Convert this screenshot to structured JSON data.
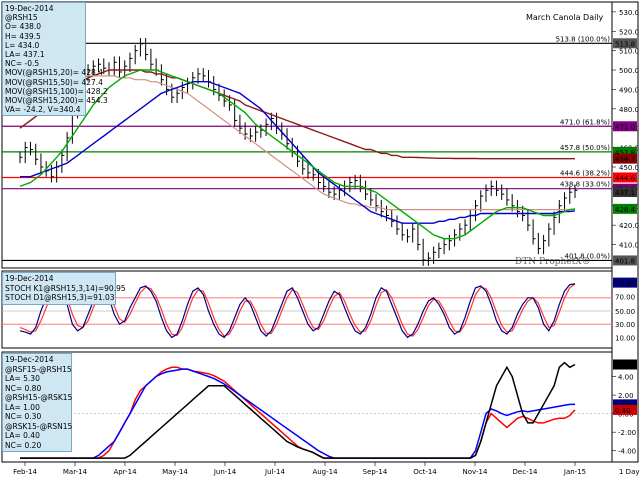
{
  "chart_data": [
    {
      "type": "line",
      "panel": "price",
      "title": "March Canola Daily",
      "ylim": [
        401,
        532
      ],
      "yticks": [
        410,
        420,
        430,
        440,
        450,
        460,
        470,
        480,
        490,
        500,
        510,
        520,
        530
      ],
      "price": [
        455,
        460,
        459,
        454,
        450,
        448,
        445,
        450,
        456,
        465,
        478,
        492,
        497,
        500,
        502,
        503,
        501,
        500,
        504,
        499,
        502,
        506,
        510,
        513.5,
        508,
        503,
        500,
        495,
        490,
        486,
        488,
        491,
        493,
        496,
        498,
        497,
        494,
        490,
        487,
        484,
        482,
        474,
        470,
        467,
        466,
        468,
        469,
        472,
        475,
        470,
        467,
        462,
        458,
        453,
        449,
        447,
        446,
        442,
        440,
        437,
        436,
        438,
        440,
        442,
        443,
        440,
        436,
        433,
        430,
        427,
        425,
        422,
        418,
        415,
        414,
        418,
        410,
        402,
        403,
        406,
        408,
        410,
        412,
        415,
        418,
        420,
        425,
        430,
        435,
        438,
        440,
        438,
        436,
        433,
        430,
        427,
        425,
        420,
        413,
        408,
        412,
        418,
        424,
        430,
        434,
        437,
        438
      ],
      "sma20": [
        440,
        441,
        442,
        444,
        446,
        449,
        452,
        455,
        458,
        462,
        466,
        470,
        474,
        478,
        482,
        485,
        488,
        491,
        493,
        495,
        497,
        498,
        499,
        500,
        500,
        500,
        500,
        499,
        498,
        497,
        496,
        495,
        494,
        493,
        492,
        491,
        490,
        489,
        488,
        486,
        484,
        482,
        480,
        478,
        475,
        472,
        470,
        468,
        466,
        464,
        462,
        460,
        458,
        456,
        454,
        452,
        450,
        448,
        446,
        444,
        442,
        441,
        440,
        440,
        440,
        440,
        439,
        438,
        437,
        435,
        433,
        431,
        429,
        427,
        425,
        423,
        421,
        419,
        417,
        415,
        414,
        413,
        413,
        413,
        414,
        415,
        417,
        419,
        421,
        423,
        425,
        427,
        428,
        429,
        429,
        429,
        429,
        428,
        427,
        426,
        425,
        425,
        425,
        426,
        427,
        428,
        428.4
      ],
      "sma50": [
        445,
        445,
        445,
        446,
        447,
        448,
        449,
        450,
        451,
        452,
        454,
        456,
        458,
        460,
        462,
        464,
        466,
        468,
        470,
        472,
        474,
        476,
        478,
        480,
        482,
        484,
        486,
        488,
        489,
        490,
        491,
        492,
        493,
        494,
        494,
        494,
        494,
        493,
        492,
        491,
        490,
        489,
        488,
        486,
        484,
        482,
        480,
        477,
        474,
        471,
        468,
        465,
        462,
        459,
        456,
        453,
        450,
        447,
        445,
        443,
        441,
        439,
        437,
        435,
        433,
        431,
        429,
        427,
        426,
        425,
        424,
        423,
        422,
        421,
        421,
        421,
        421,
        421,
        421,
        421,
        422,
        422,
        423,
        423,
        424,
        424,
        425,
        425,
        426,
        426,
        426,
        426,
        426,
        426,
        426,
        426,
        426,
        426,
        426,
        426,
        426,
        426,
        426,
        427,
        427,
        427,
        427.4
      ],
      "sma100": [
        480,
        482,
        484,
        486,
        488,
        489,
        490,
        491,
        492,
        493,
        494,
        495,
        496,
        497,
        497,
        497,
        497,
        497,
        497,
        496,
        496,
        496,
        495,
        495,
        495,
        494,
        494,
        493,
        492,
        491,
        490,
        489,
        488,
        486,
        484,
        482,
        480,
        478,
        476,
        474,
        472,
        470,
        468,
        466,
        464,
        462,
        460,
        458,
        456,
        454,
        452,
        450,
        448,
        446,
        444,
        442,
        440,
        438,
        436,
        435,
        434,
        433,
        432,
        431,
        431,
        430,
        430,
        429,
        429,
        429,
        428,
        428,
        428,
        428,
        428,
        428,
        428,
        428,
        428,
        428,
        428,
        428,
        428,
        428,
        428,
        428,
        428,
        428,
        428,
        428,
        428,
        428,
        428,
        428,
        428,
        428,
        428,
        428,
        428,
        428,
        428,
        428,
        428,
        428,
        428,
        428,
        428.2
      ],
      "sma200": [
        470,
        472,
        474,
        476,
        478,
        480,
        482,
        484,
        486,
        488,
        490,
        492,
        494,
        496,
        497,
        498,
        499,
        500,
        500,
        500,
        500,
        500,
        500,
        500,
        499,
        499,
        498,
        498,
        497,
        496,
        496,
        495,
        494,
        493,
        492,
        491,
        490,
        489,
        488,
        487,
        486,
        485,
        484,
        482,
        481,
        480,
        479,
        478,
        477,
        476,
        475,
        474,
        473,
        472,
        471,
        470,
        469,
        468,
        467,
        466,
        465,
        464,
        463,
        462,
        461,
        460,
        459,
        459,
        458,
        457,
        457,
        456,
        456,
        455,
        455,
        455,
        454.9,
        454.8,
        454.7,
        454.6,
        454.5,
        454.5,
        454.5,
        454.4,
        454.4,
        454.4,
        454.4,
        454.4,
        454.3,
        454.3,
        454.3,
        454.3,
        454.3,
        454.3,
        454.3,
        454.3,
        454.3,
        454.3,
        454.3,
        454.3,
        454.3,
        454.3,
        454.3,
        454.3,
        454.3,
        454.3,
        454.3
      ],
      "fib_levels": [
        {
          "label": "513.8 (100.0%)",
          "value": 513.8,
          "color": "#000000"
        },
        {
          "label": "471.0 (61.8%)",
          "value": 471.0,
          "color": "#800080"
        },
        {
          "label": "457.8 (50.0%)",
          "value": 457.8,
          "color": "#008000"
        },
        {
          "label": "444.6 (38.2%)",
          "value": 444.6,
          "color": "#ff0000"
        },
        {
          "label": "438.8 (33.0%)",
          "value": 438.8,
          "color": "#800080"
        },
        {
          "label": "401.8 (0.0%)",
          "value": 401.8,
          "color": "#000000"
        }
      ],
      "right_tags": [
        {
          "text": "513.8",
          "value": 513.8,
          "color": "#555555"
        },
        {
          "text": "471.0",
          "value": 471.0,
          "color": "#800080"
        },
        {
          "text": "457.8",
          "value": 457.8,
          "color": "#008000"
        },
        {
          "text": "454.3",
          "value": 454.3,
          "color": "#8b0000"
        },
        {
          "text": "444.6",
          "value": 444.6,
          "color": "#ff0000"
        },
        {
          "text": "438.8",
          "value": 438.8,
          "color": "#800080"
        },
        {
          "text": "437.1",
          "value": 437.1,
          "color": "#333333"
        },
        {
          "text": "428.4",
          "value": 428.4,
          "color": "#008000"
        },
        {
          "text": "401.8",
          "value": 401.8,
          "color": "#555555"
        }
      ]
    },
    {
      "type": "line",
      "panel": "stochastic",
      "ylim": [
        0,
        100
      ],
      "yticks": [
        10,
        30,
        50,
        70,
        90
      ],
      "k": [
        20,
        18,
        15,
        25,
        50,
        70,
        85,
        88,
        80,
        60,
        30,
        20,
        25,
        45,
        65,
        80,
        85,
        70,
        45,
        30,
        35,
        55,
        70,
        85,
        88,
        80,
        65,
        40,
        20,
        10,
        15,
        35,
        60,
        80,
        85,
        75,
        50,
        30,
        15,
        10,
        20,
        40,
        60,
        70,
        60,
        40,
        20,
        12,
        20,
        40,
        60,
        80,
        85,
        70,
        50,
        30,
        20,
        25,
        45,
        65,
        80,
        75,
        55,
        35,
        20,
        15,
        25,
        45,
        70,
        85,
        80,
        60,
        40,
        20,
        10,
        15,
        30,
        50,
        65,
        70,
        60,
        45,
        25,
        15,
        20,
        40,
        65,
        85,
        88,
        80,
        60,
        35,
        20,
        15,
        25,
        45,
        60,
        70,
        70,
        55,
        30,
        20,
        35,
        60,
        80,
        90,
        91.03
      ],
      "d": [
        25,
        22,
        18,
        20,
        35,
        55,
        75,
        85,
        85,
        70,
        45,
        28,
        25,
        35,
        55,
        72,
        82,
        78,
        58,
        38,
        33,
        45,
        62,
        78,
        86,
        84,
        72,
        52,
        30,
        15,
        13,
        25,
        48,
        70,
        82,
        80,
        62,
        40,
        22,
        12,
        15,
        30,
        50,
        65,
        65,
        50,
        30,
        16,
        16,
        30,
        50,
        70,
        82,
        78,
        60,
        40,
        25,
        22,
        35,
        55,
        72,
        78,
        65,
        45,
        28,
        18,
        20,
        35,
        58,
        78,
        82,
        70,
        50,
        30,
        15,
        12,
        22,
        40,
        58,
        68,
        65,
        52,
        35,
        20,
        18,
        30,
        52,
        75,
        86,
        84,
        70,
        48,
        28,
        18,
        20,
        35,
        52,
        65,
        70,
        62,
        42,
        25,
        28,
        48,
        70,
        85,
        90.95
      ],
      "labels": [
        "STOCH K1@RSH15,3,14)=90.95",
        "STOCH D1@RSH15,3)=91.03"
      ],
      "date": "19-Dec-2014",
      "right_tags": [
        {
          "text": "90.95",
          "value": 93,
          "color": "#000080"
        },
        {
          "text": "70.00",
          "value": 72,
          "color": "#222222"
        },
        {
          "text": "50.00",
          "value": 50,
          "color": "#222222"
        },
        {
          "text": "30.00",
          "value": 30,
          "color": "#222222"
        },
        {
          "text": "10.00",
          "value": 10,
          "color": "#222222"
        }
      ]
    },
    {
      "type": "line",
      "panel": "spreads",
      "ylim": [
        -5,
        6
      ],
      "yticks": [
        -4,
        -2,
        0,
        2,
        4
      ],
      "tick_labels": [
        "-4.00",
        "-2.00",
        "0.00",
        "2.00",
        "4.00"
      ],
      "spread_black": [
        -5,
        -5,
        -5,
        -5,
        -5,
        -5,
        -5,
        -5,
        -5,
        -5,
        -5,
        -5,
        -5,
        -5,
        -5,
        -5,
        -5,
        -5,
        -5,
        -5,
        -4.8,
        -4.5,
        -4,
        -3.5,
        -3,
        -2.5,
        -2,
        -1.5,
        -1,
        -0.5,
        0,
        0.5,
        1,
        1.5,
        2,
        2.5,
        3,
        3,
        3,
        3,
        2.5,
        2,
        1.5,
        1,
        0.5,
        0,
        -0.5,
        -1,
        -1.5,
        -2,
        -2.5,
        -3,
        -3.3,
        -3.6,
        -3.8,
        -4,
        -4.2,
        -4.5,
        -4.8,
        -5,
        -5,
        -5,
        -5,
        -5,
        -5,
        -5,
        -5,
        -5,
        -5,
        -5,
        -5,
        -5,
        -5,
        -5,
        -5,
        -5,
        -5,
        -5,
        -5,
        -5,
        -5,
        -5,
        -5,
        -5,
        -5,
        -5,
        -5,
        -4.5,
        -3,
        -1,
        1,
        3,
        4,
        5,
        4,
        2,
        0,
        -1,
        -1,
        0,
        1,
        2,
        3,
        5,
        5.5,
        5,
        5.3
      ],
      "spread_blue": [
        -5,
        -5,
        -5,
        -5,
        -5,
        -5,
        -5,
        -5,
        -5,
        -5,
        -5,
        -5,
        -5,
        -5,
        -5,
        -4.5,
        -4,
        -3.5,
        -3,
        -2,
        -1,
        0,
        1,
        2,
        3,
        3.5,
        4,
        4.3,
        4.5,
        4.6,
        4.7,
        4.8,
        4.8,
        4.6,
        4.4,
        4.2,
        4,
        3.8,
        3.5,
        3.2,
        2.8,
        2.4,
        2,
        1.6,
        1.2,
        0.8,
        0.4,
        0,
        -0.4,
        -0.8,
        -1.2,
        -1.6,
        -2,
        -2.4,
        -2.8,
        -3.2,
        -3.6,
        -4,
        -4.3,
        -4.6,
        -4.8,
        -5,
        -5,
        -5,
        -5,
        -5,
        -5,
        -5,
        -5,
        -5,
        -5,
        -5,
        -5,
        -5,
        -5,
        -5,
        -5,
        -5,
        -5,
        -5,
        -5,
        -5,
        -5,
        -5,
        -5,
        -5,
        -5,
        -4,
        -2,
        0,
        0.5,
        0.3,
        0,
        -0.2,
        0,
        0.2,
        0.3,
        0.2,
        0.3,
        0.4,
        0.5,
        0.6,
        0.7,
        0.8,
        0.9,
        1.0,
        1.0
      ],
      "spread_red": [
        -5,
        -5,
        -5,
        -5,
        -5,
        -5,
        -5,
        -5,
        -5,
        -5,
        -5,
        -5,
        -5,
        -5,
        -5,
        -5,
        -4.5,
        -4,
        -3,
        -2,
        -1,
        0,
        1.5,
        2.5,
        3,
        3.5,
        4,
        4.5,
        4.8,
        5,
        5,
        4.8,
        4.8,
        4.6,
        4.5,
        4.4,
        4.3,
        4.1,
        3.8,
        3.5,
        3,
        2.5,
        2,
        1.5,
        1,
        0.5,
        0,
        -0.5,
        -1,
        -1.5,
        -2,
        -2.5,
        -3,
        -3.5,
        -3.8,
        -4,
        -4.2,
        -4.5,
        -4.8,
        -5,
        -5,
        -5,
        -5,
        -5,
        -5,
        -5,
        -5,
        -5,
        -5,
        -5,
        -5,
        -5,
        -5,
        -5,
        -5,
        -5,
        -5,
        -5,
        -5,
        -5,
        -5,
        -5,
        -5,
        -5,
        -5,
        -5,
        -5,
        -4.5,
        -3,
        -1,
        0,
        -0.5,
        -1,
        -1.5,
        -1,
        -0.5,
        -0.3,
        -0.5,
        -0.8,
        -1,
        -1,
        -0.8,
        -0.6,
        -0.5,
        -0.5,
        -0.2,
        0.4
      ],
      "date": "19-Dec-2014",
      "right_tags": [
        {
          "text": "5.30",
          "value": 5.3,
          "color": "#000000"
        },
        {
          "text": "1.00",
          "value": 1.0,
          "color": "#000080"
        },
        {
          "text": "0.40",
          "value": 0.4,
          "color": "#cc0000"
        }
      ]
    }
  ],
  "x_axis": {
    "labels": [
      "Feb-14",
      "Mar-14",
      "Apr-14",
      "May-14",
      "Jun-14",
      "Jul-14",
      "Aug-14",
      "Sep-14",
      "Oct-14",
      "Nov-14",
      "Dec-14",
      "Jan-15"
    ],
    "right_label": "1 Day"
  },
  "price_info": {
    "date": "19-Dec-2014",
    "rows": [
      "@RSH15",
      "O= 438.0",
      "H= 439.5",
      "L= 434.0",
      "LA= 437.1",
      "NC= -0.5",
      "MOV(@RSH15,20)= 428.4",
      "MOV(@RSH15,50)= 427.4",
      "MOV(@RSH15,100)= 428.2",
      "MOV(@RSH15,200)= 454.3",
      "VA= -24.2, V=340.4"
    ]
  },
  "spread_info": {
    "rows": [
      "@RSF15-@RSH15",
      "LA= 5.30",
      "NC= 0.80",
      "@RSH15-@RSK15",
      "LA= 1.00",
      "NC= 0.30",
      "@RSK15-@RSN15",
      "LA= 0.40",
      "NC= 0.20"
    ]
  },
  "watermark": "DTN ProphetX®",
  "colors": {
    "price": "#000000",
    "sma20": "#00aa00",
    "sma50": "#0000cc",
    "sma100": "#d09080",
    "sma200": "#8b1a1a",
    "k": "#000080",
    "d": "#ff3333",
    "panelBorder": "#000000"
  }
}
